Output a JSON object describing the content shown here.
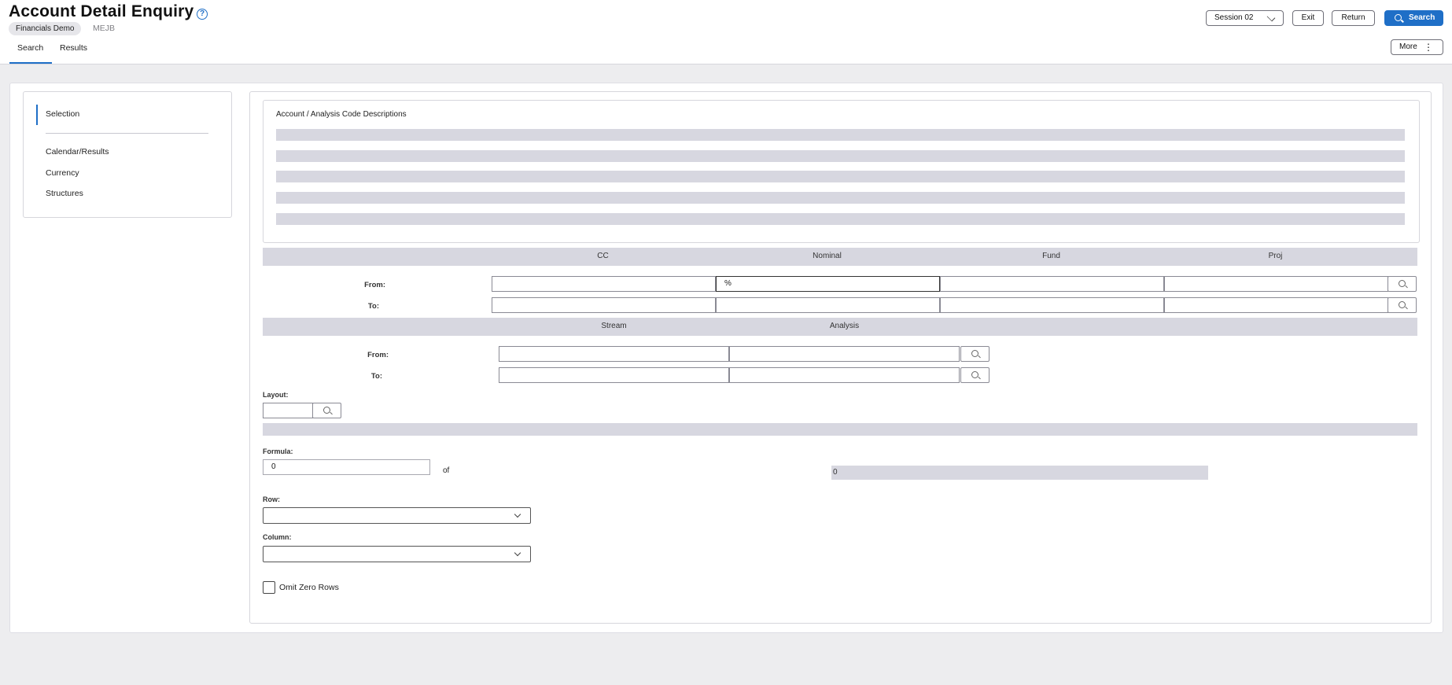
{
  "header": {
    "title": "Account Detail Enquiry",
    "help_icon": "?",
    "badge": "Financials Demo",
    "code": "MEJB"
  },
  "tabs": [
    {
      "label": "Search",
      "active": true
    },
    {
      "label": "Results",
      "active": false
    }
  ],
  "toolbar": {
    "session_label": "Session 02",
    "exit_label": "Exit",
    "return_label": "Return",
    "search_label": "Search",
    "more_label": "More",
    "more_icon": "⋮"
  },
  "sidebar": {
    "items": [
      {
        "label": "Selection",
        "active": true
      },
      {
        "label": "Calendar/Results"
      },
      {
        "label": "Currency"
      },
      {
        "label": "Structures"
      }
    ]
  },
  "descriptions": {
    "title": "Account / Analysis Code Descriptions"
  },
  "codes": {
    "columns": [
      "CC",
      "Nominal",
      "Fund",
      "Proj"
    ],
    "from_label": "From:",
    "to_label": "To:",
    "from_values": [
      "",
      "%",
      "",
      ""
    ],
    "to_values": [
      "",
      "",
      "",
      ""
    ]
  },
  "analysis": {
    "columns": [
      "Stream",
      "Analysis"
    ],
    "from_label": "From:",
    "to_label": "To:",
    "from_values": [
      "",
      ""
    ],
    "to_values": [
      "",
      ""
    ]
  },
  "layout": {
    "label": "Layout:",
    "value": ""
  },
  "formula": {
    "label": "Formula:",
    "value": "0",
    "of_text": "of",
    "total": "0"
  },
  "row": {
    "label": "Row:",
    "value": ""
  },
  "column": {
    "label": "Column:",
    "value": ""
  },
  "omit_zero": {
    "label": "Omit Zero Rows",
    "checked": false
  },
  "colors": {
    "accent": "#1f6fc7",
    "band": "#d7d7e0",
    "background": "#ededef"
  }
}
